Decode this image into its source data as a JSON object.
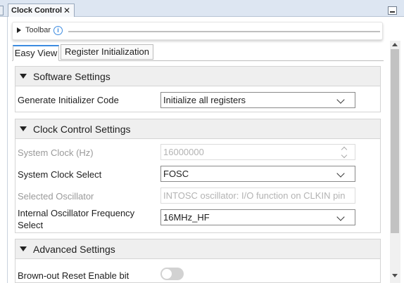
{
  "window": {
    "tab_title": "Clock Control",
    "close_glyph": "✕"
  },
  "toolbar": {
    "label": "Toolbar",
    "info_glyph": "i"
  },
  "tabs": [
    {
      "label": "Easy View",
      "active": true
    },
    {
      "label": "Register Initialization",
      "active": false
    }
  ],
  "software_settings": {
    "title": "Software Settings",
    "generate_initializer_label": "Generate Initializer Code",
    "generate_initializer_value": "Initialize all registers"
  },
  "clock_control": {
    "title": "Clock Control Settings",
    "system_clock_label": "System Clock (Hz)",
    "system_clock_value": "16000000",
    "system_clock_select_label": "System Clock Select",
    "system_clock_select_value": "FOSC",
    "selected_oscillator_label": "Selected Oscillator",
    "selected_oscillator_value": "INTOSC oscillator: I/O function on CLKIN pin",
    "internal_osc_label_line1": "Internal Oscillator Frequency",
    "internal_osc_label_line2": "Select",
    "internal_osc_value": "16MHz_HF"
  },
  "advanced": {
    "title": "Advanced Settings",
    "brownout_label": "Brown-out Reset Enable bit",
    "brownout_enabled": false
  },
  "colors": {
    "accent": "#3c8be0",
    "section_bg": "#efefef",
    "disabled_text": "#9a9a9a"
  },
  "icons": [
    "close-icon",
    "minimize-icon",
    "info-icon",
    "chevron-down-icon",
    "caret-right-icon",
    "caret-down-icon"
  ]
}
